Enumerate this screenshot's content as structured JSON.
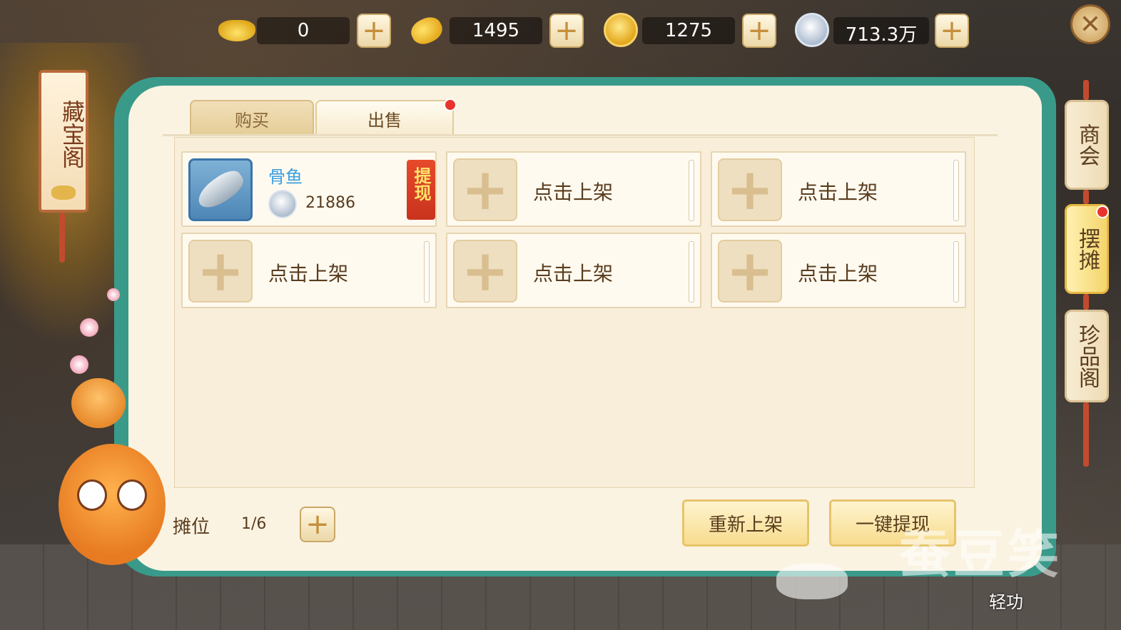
{
  "currencies": [
    {
      "icon": "gold-ingot-icon",
      "value": "0"
    },
    {
      "icon": "gold-nugget-icon",
      "value": "1495"
    },
    {
      "icon": "gold-coin-icon",
      "value": "1275"
    },
    {
      "icon": "silver-coin-icon",
      "value": "713.3万"
    }
  ],
  "add_symbol": "+",
  "close_symbol": "✕",
  "title_banner": "藏宝阁",
  "tabs": [
    {
      "label": "购买",
      "active": false
    },
    {
      "label": "出售",
      "active": true
    }
  ],
  "listed_item": {
    "name": "骨鱼",
    "icon": "fish-icon",
    "price": "21886",
    "withdraw_label": "提现"
  },
  "empty_slot_label": "点击上架",
  "empty_slots": [
    "点击上架",
    "点击上架",
    "点击上架",
    "点击上架",
    "点击上架"
  ],
  "stall": {
    "label": "摊位",
    "count": "1/6"
  },
  "buttons": {
    "relist": "重新上架",
    "withdraw_all": "一键提现"
  },
  "side_nav": [
    {
      "label": "商会",
      "active": false
    },
    {
      "label": "摆摊",
      "active": true
    },
    {
      "label": "珍品阁",
      "active": false
    }
  ],
  "watermark_text": "蚕豆笑",
  "skill_label": "轻功",
  "colors": {
    "accent_teal": "#3a9a8a",
    "panel_bg": "#fbf3e2",
    "item_name": "#3a9fe0",
    "notify_red": "#e8342d"
  }
}
